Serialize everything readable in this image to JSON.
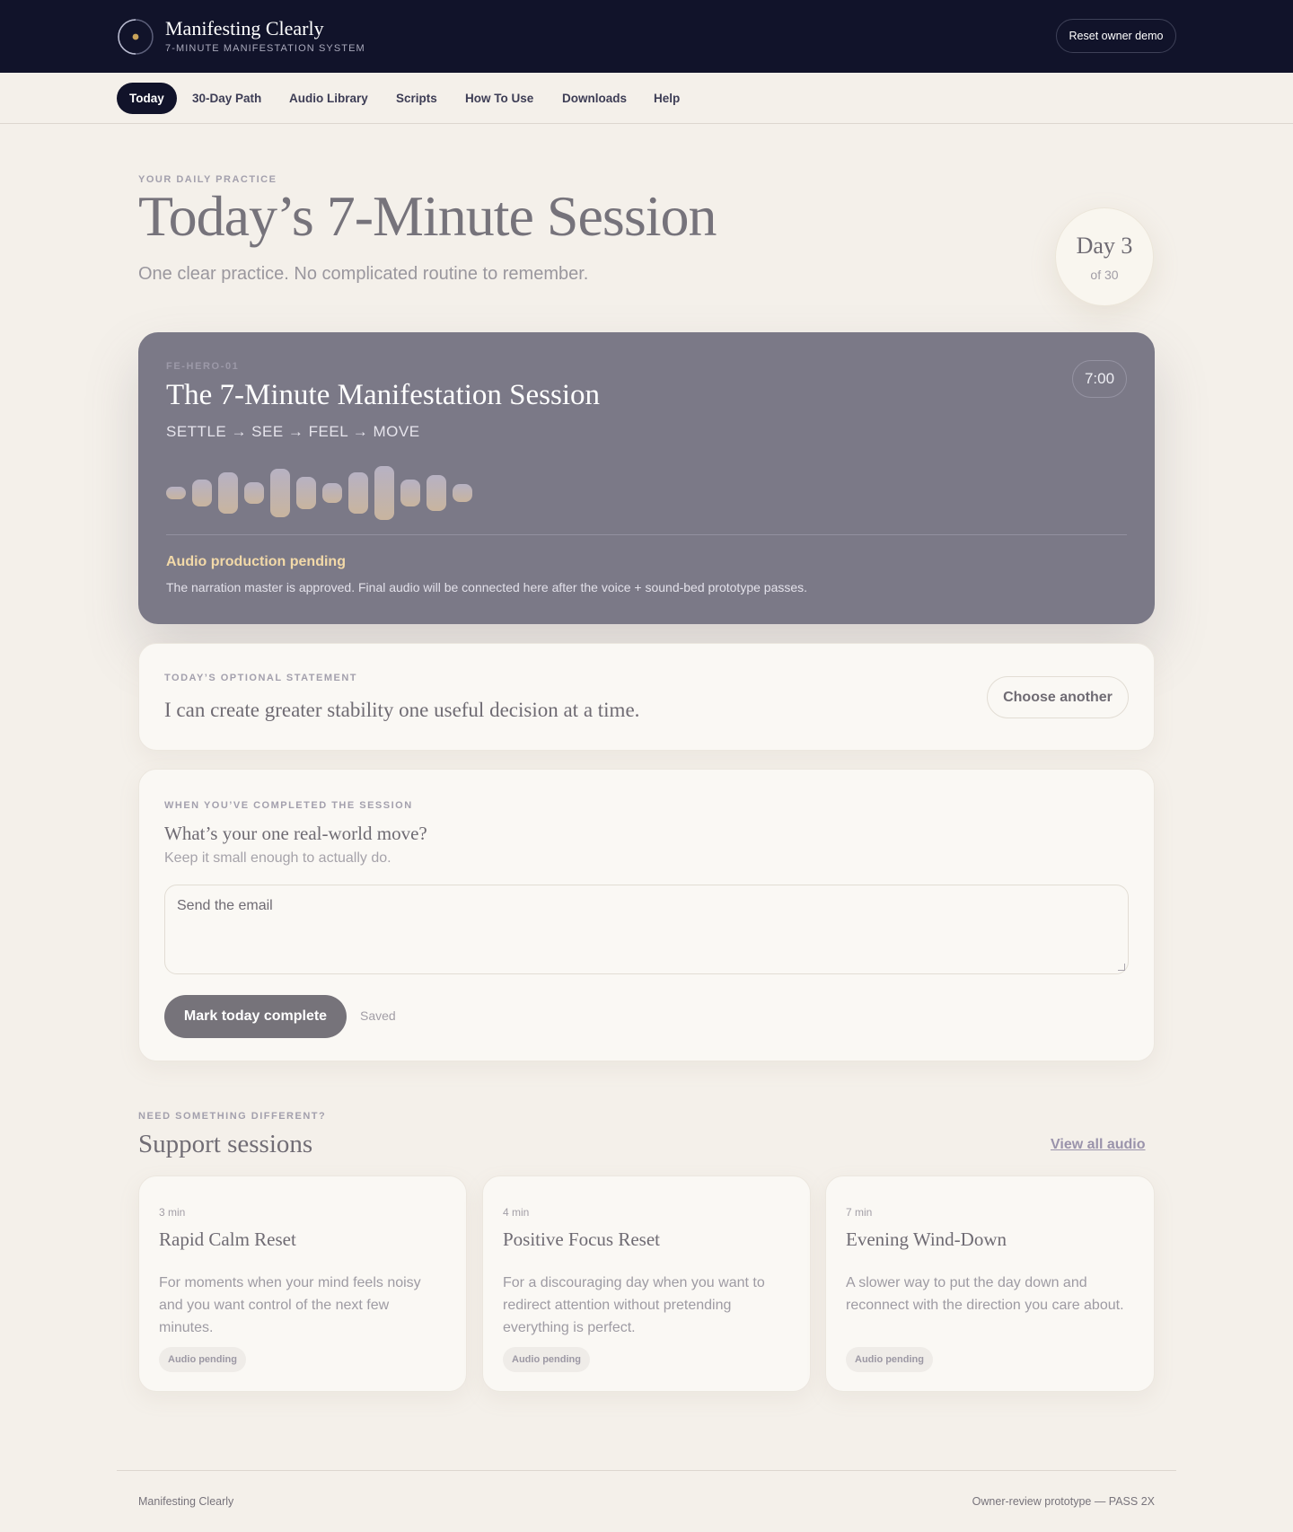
{
  "brand": {
    "title": "Manifesting Clearly",
    "subtitle": "7-MINUTE MANIFESTATION SYSTEM",
    "logo_icon": "eclipse-ring-icon",
    "accent": "#c9a35a"
  },
  "header": {
    "reset_label": "Reset owner demo"
  },
  "nav": {
    "items": [
      {
        "label": "Today",
        "active": true
      },
      {
        "label": "30-Day Path"
      },
      {
        "label": "Audio Library"
      },
      {
        "label": "Scripts"
      },
      {
        "label": "How To Use"
      },
      {
        "label": "Downloads"
      },
      {
        "label": "Help"
      }
    ]
  },
  "hero": {
    "eyebrow": "YOUR DAILY PRACTICE",
    "title": "Today’s 7-Minute Session",
    "subtitle": "One clear practice. No complicated routine to remember.",
    "day_label": "Day 3",
    "day_of": "of 30",
    "day_current": 3,
    "day_total": 30
  },
  "player": {
    "id": "FE-HERO-01",
    "title": "The 7-Minute Manifestation Session",
    "steps": "SETTLE → SEE → FEEL → MOVE",
    "duration": "7:00",
    "pending_title": "Audio production pending",
    "pending_desc": "The narration master is approved. Final audio will be connected here after the voice + sound-bed prototype passes.",
    "pending_color": "#f2d9a8"
  },
  "statement": {
    "eyebrow": "TODAY’S OPTIONAL STATEMENT",
    "text": "I can create greater stability one useful decision at a time.",
    "choose_label": "Choose another"
  },
  "move": {
    "eyebrow": "WHEN YOU’VE COMPLETED THE SESSION",
    "question": "What’s your one real-world move?",
    "hint": "Keep it small enough to actually do.",
    "value": "Send the email",
    "complete_label": "Mark today complete",
    "status": "Saved"
  },
  "support": {
    "eyebrow": "NEED SOMETHING DIFFERENT?",
    "title": "Support sessions",
    "view_all": "View all audio",
    "cards": [
      {
        "duration": "3 min",
        "title": "Rapid Calm Reset",
        "desc": "For moments when your mind feels noisy and you want control of the next few minutes.",
        "badge": "Audio pending"
      },
      {
        "duration": "4 min",
        "title": "Positive Focus Reset",
        "desc": "For a discouraging day when you want to redirect attention without pretending everything is perfect.",
        "badge": "Audio pending"
      },
      {
        "duration": "7 min",
        "title": "Evening Wind-Down",
        "desc": "A slower way to put the day down and reconnect with the direction you care about.",
        "badge": "Audio pending"
      }
    ]
  },
  "footer": {
    "left": "Manifesting Clearly",
    "right": "Owner-review prototype — PASS 2X"
  }
}
